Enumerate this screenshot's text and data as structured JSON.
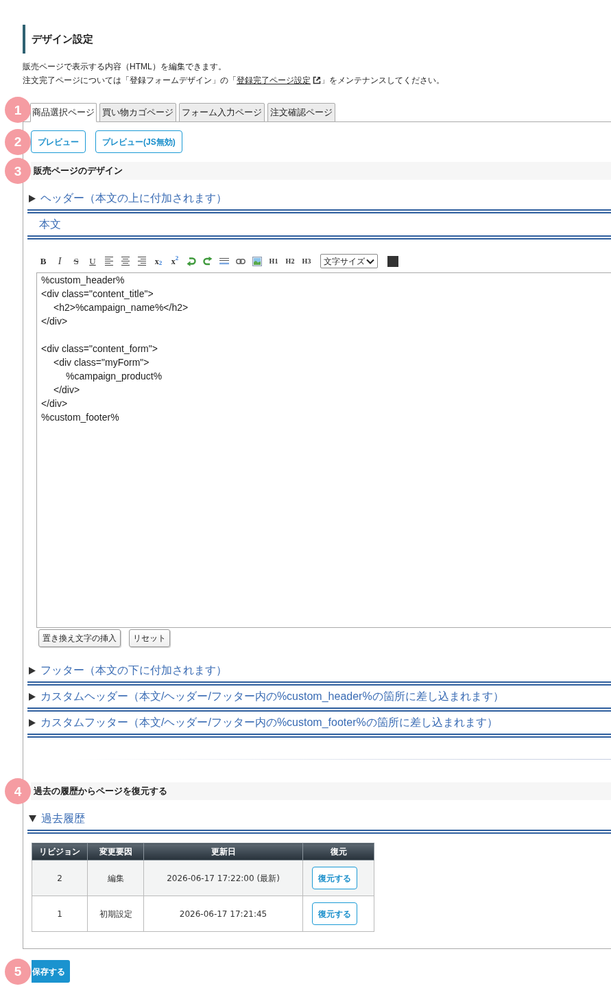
{
  "heading": "デザイン設定",
  "description": {
    "line_1": "販売ページで表示する内容（HTML）を編集できます。",
    "line_2": {
      "before": "注文完了ページについては「登録フォームデザイン」の「",
      "link": "登録完了ページ設定",
      "after": "」をメンテナンスしてください。"
    }
  },
  "tabs": {
    "marker": "1",
    "items": [
      {
        "label": "商品選択ページ",
        "selected": true
      },
      {
        "label": "買い物カゴページ",
        "selected": false
      },
      {
        "label": "フォーム入力ページ",
        "selected": false
      },
      {
        "label": "注文確認ページ",
        "selected": false
      }
    ]
  },
  "preview": {
    "marker": "2",
    "buttons": [
      "プレビュー",
      "プレビュー(JS無効)"
    ]
  },
  "design": {
    "marker": "3",
    "title": "販売ページのデザイン",
    "panels": [
      {
        "kind": "accordion",
        "title": "ヘッダー（本文の上に付加されます）",
        "expanded": false
      },
      {
        "kind": "editor",
        "title": "本文",
        "toolbar": [
          {
            "kind": "bold",
            "label": "B"
          },
          {
            "kind": "italic",
            "label": "I"
          },
          {
            "kind": "strike",
            "label": "S"
          },
          {
            "kind": "underline",
            "label": "U"
          },
          {
            "kind": "align_left"
          },
          {
            "kind": "align_center"
          },
          {
            "kind": "align_right"
          },
          {
            "kind": "subscript",
            "label": "x$_{2}$"
          },
          {
            "kind": "superscript",
            "label": "x$^{2}$"
          },
          {
            "kind": "undo"
          },
          {
            "kind": "redo"
          },
          {
            "kind": "rule"
          },
          {
            "kind": "link"
          },
          {
            "kind": "image"
          },
          {
            "kind": "heading",
            "label": "H1"
          },
          {
            "kind": "heading",
            "label": "H2"
          },
          {
            "kind": "heading",
            "label": "H3"
          },
          {
            "kind": "select",
            "label": "文字サイズ"
          },
          {
            "kind": "swatch"
          }
        ],
        "code_blocks": [
          [
            "%custom_header%",
            "<div class=\"content_title\">",
            "\t<h2>%campaign_name%</h2>",
            "</div>"
          ],
          [
            "<div class=\"content_form\">",
            "\t<div class=\"myForm\">",
            "\t\t%campaign_product%",
            "\t</div>",
            "</div>",
            "%custom_footer%"
          ]
        ],
        "buttons": [
          "置き換え文字の挿入",
          "リセット"
        ]
      },
      {
        "kind": "accordion",
        "title": "フッター（本文の下に付加されます）",
        "expanded": false
      },
      {
        "kind": "accordion",
        "title": "カスタムヘッダー（本文/ヘッダー/フッター内の%custom_header%の箇所に差し込まれます）",
        "expanded": false
      },
      {
        "kind": "accordion",
        "title": "カスタムフッター（本文/ヘッダー/フッター内の%custom_footer%の箇所に差し込まれます）",
        "expanded": false
      }
    ]
  },
  "history": {
    "marker": "4",
    "title": "過去の履歴からページを復元する",
    "panel": {
      "title": "過去履歴",
      "expanded": true,
      "table": {
        "columns": [
          "リビジョン",
          "変更要因",
          "更新日",
          "復元"
        ],
        "rows": [
          {
            "cells": [
              "2",
              "編集",
              "2026-06-17 17:22:00 (最新)"
            ],
            "action": "復元する"
          },
          {
            "cells": [
              "1",
              "初期設定",
              "2026-06-17 17:21:45"
            ],
            "action": "復元する"
          }
        ]
      }
    }
  },
  "save": {
    "marker": "5",
    "label": "保存する"
  }
}
